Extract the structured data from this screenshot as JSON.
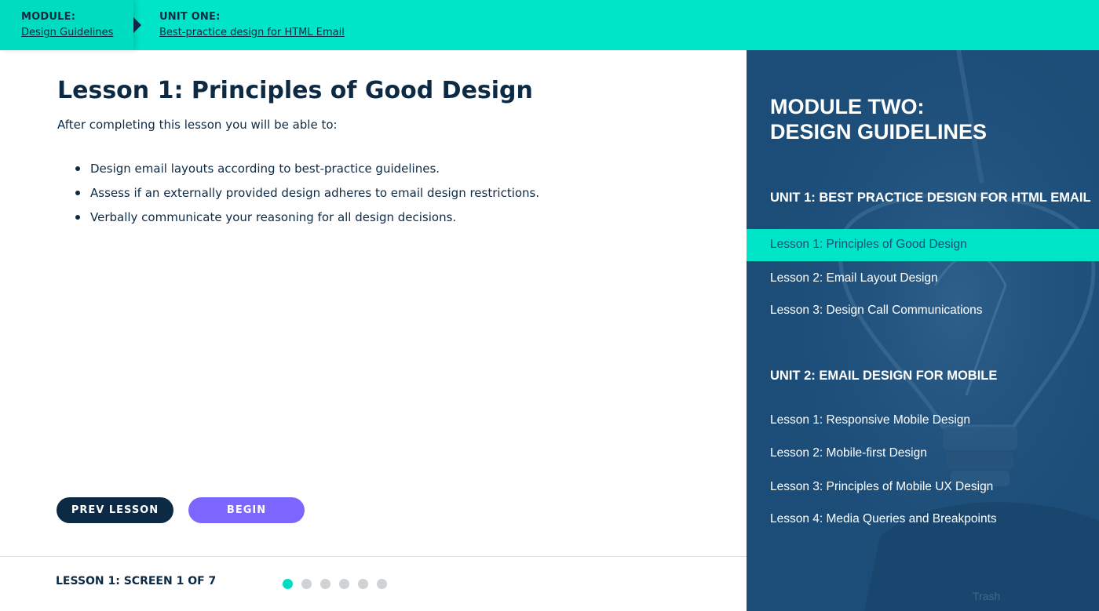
{
  "breadcrumb": {
    "module_label": "MODULE:",
    "module_link": "Design Guidelines",
    "unit_label": "UNIT ONE:",
    "unit_link": "Best-practice design for HTML Email"
  },
  "lesson": {
    "title": "Lesson 1: Principles of Good Design",
    "intro": "After completing this lesson you will be able to:",
    "objectives": [
      "Design email layouts according to best-practice guidelines.",
      "Assess if an externally provided design adheres to email design restrictions.",
      "Verbally communicate your reasoning for all design decisions."
    ]
  },
  "buttons": {
    "prev_label": "PREV LESSON",
    "begin_label": "BEGIN"
  },
  "footer": {
    "screen_counter": "LESSON 1: SCREEN 1 OF 7",
    "dots_total": 6,
    "dot_active_index": 0
  },
  "sidebar": {
    "module_heading_line1": "MODULE TWO:",
    "module_heading_line2": "DESIGN GUIDELINES",
    "units": [
      {
        "heading": "UNIT 1: BEST PRACTICE DESIGN FOR HTML EMAIL",
        "lessons": [
          "Lesson 1: Principles of Good Design",
          "Lesson 2: Email Layout Design",
          "Lesson 3: Design Call Communications"
        ]
      },
      {
        "heading": "UNIT 2: EMAIL DESIGN FOR MOBILE",
        "lessons": [
          "Lesson 1: Responsive Mobile Design",
          "Lesson 2: Mobile-first Design",
          "Lesson 3: Principles of Mobile UX Design",
          "Lesson 4: Media Queries and Breakpoints"
        ]
      }
    ],
    "watermark": "Trash",
    "background_icon": "lightbulb-image"
  },
  "colors": {
    "accent": "#00e5c8",
    "navy": "#0d2a45",
    "sidebar_blue": "#1c4d78",
    "begin_purple": "#7b66ff",
    "dot_inactive": "#cfd3d6"
  }
}
